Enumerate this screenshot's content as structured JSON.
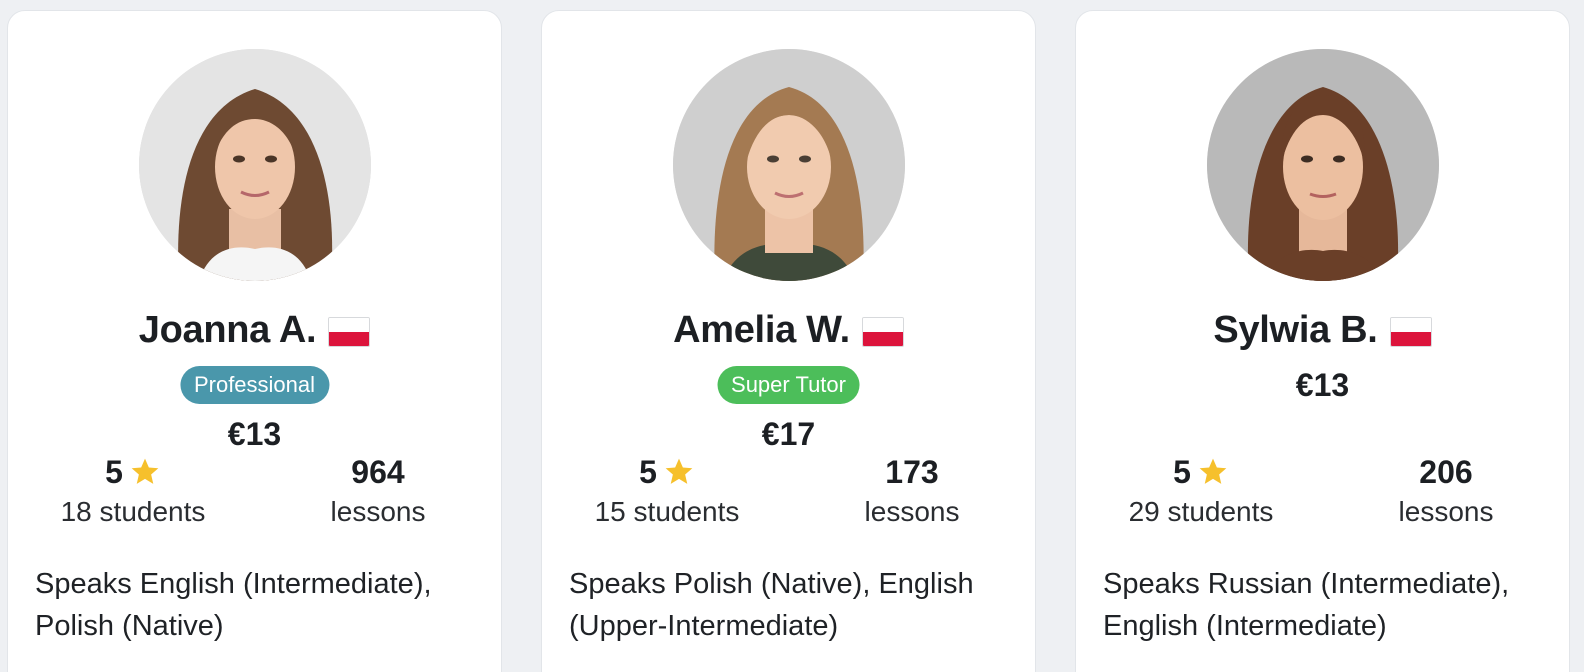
{
  "tutors": [
    {
      "name": "Joanna A.",
      "badge": "Professional",
      "badge_color": "#4a97ab",
      "price": "€13",
      "rating": "5",
      "students": "18 students",
      "lessons_count": "964",
      "lessons_label": "lessons",
      "speaks": "Speaks English (Intermediate), Polish (Native)"
    },
    {
      "name": "Amelia W.",
      "badge": "Super Tutor",
      "badge_color": "#4cbe5a",
      "price": "€17",
      "rating": "5",
      "students": "15 students",
      "lessons_count": "173",
      "lessons_label": "lessons",
      "speaks": "Speaks Polish (Native), English (Upper-Intermediate)"
    },
    {
      "name": "Sylwia B.",
      "price": "€13",
      "rating": "5",
      "students": "29 students",
      "lessons_count": "206",
      "lessons_label": "lessons",
      "speaks": "Speaks Russian (Intermediate), English (Intermediate)"
    }
  ],
  "icons": {
    "star": "star-icon",
    "flag": "poland-flag-icon",
    "avatar": "tutor-photo"
  },
  "colors": {
    "star": "#f6c02c",
    "flag_red": "#dc143c",
    "background": "#eef0f3"
  }
}
